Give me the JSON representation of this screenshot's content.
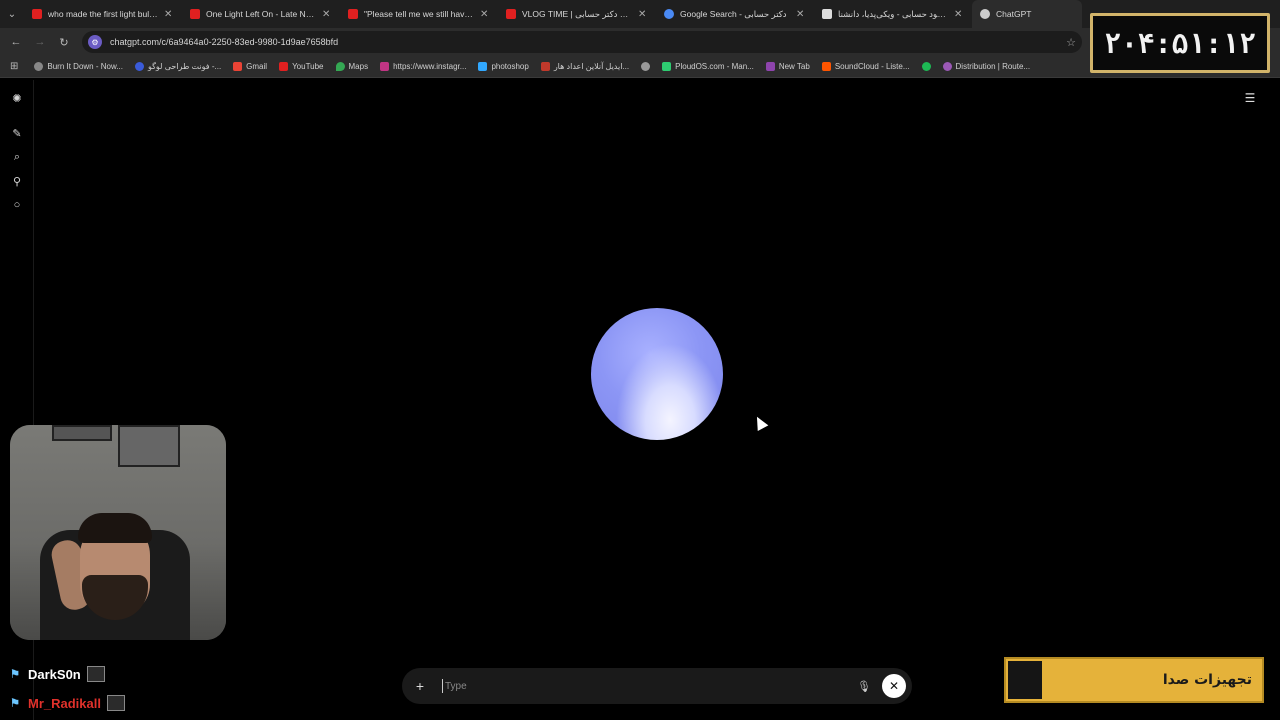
{
  "tabs": [
    {
      "title": "who made the first light bulb -",
      "fav_color": "#e02020"
    },
    {
      "title": "One Light Left On - Late Night",
      "fav_color": "#e02020"
    },
    {
      "title": "\"Please tell me we still have co",
      "fav_color": "#e02020"
    },
    {
      "title": "VLOG TIME | م خونه دکتر حسابی",
      "fav_color": "#e02020"
    },
    {
      "title": "Google Search - دکتر حسابی",
      "fav_color": "#4a8af4"
    },
    {
      "title": "محمود حسابی - ویکی‌پدیا، دانشنا",
      "fav_color": "#dddddd"
    },
    {
      "title": "ChatGPT",
      "fav_color": "#cccccc"
    }
  ],
  "address": {
    "url": "chatgpt.com/c/6a9464a0-2250-83ed-9980-1d9ae7658bfd"
  },
  "bookmarks": [
    {
      "label": "Burn It Down - Now...",
      "color": "#888888"
    },
    {
      "label": "فونت طراحی لوگو -...",
      "color": "#3a5bd9"
    },
    {
      "label": "Gmail",
      "color": "#ea4335"
    },
    {
      "label": "YouTube",
      "color": "#e02020"
    },
    {
      "label": "Maps",
      "color": "#34a853"
    },
    {
      "label": "https://www.instagr...",
      "color": "#c13584"
    },
    {
      "label": "photoshop",
      "color": "#31a8ff"
    },
    {
      "label": "ایدیل آنلاین اعداد هار...",
      "color": "#c0392b"
    },
    {
      "label": "",
      "color": "#999999"
    },
    {
      "label": "PloudOS.com - Man...",
      "color": "#2ecc71"
    },
    {
      "label": "New Tab",
      "color": "#8e44ad"
    },
    {
      "label": "SoundCloud - Liste...",
      "color": "#ff5500"
    },
    {
      "label": "",
      "color": "#1db954"
    },
    {
      "label": "Distribution | Route...",
      "color": "#9b59b6"
    }
  ],
  "composer": {
    "placeholder": "Type"
  },
  "timer": {
    "text": "۲۰۴:۵۱:۱۲"
  },
  "chat": [
    {
      "name": "DarkS0n",
      "color": "#ffffff"
    },
    {
      "name": "Mr_Radikall",
      "color": "#e0312b"
    }
  ],
  "banner": {
    "text": "تجهیزات صدا"
  }
}
